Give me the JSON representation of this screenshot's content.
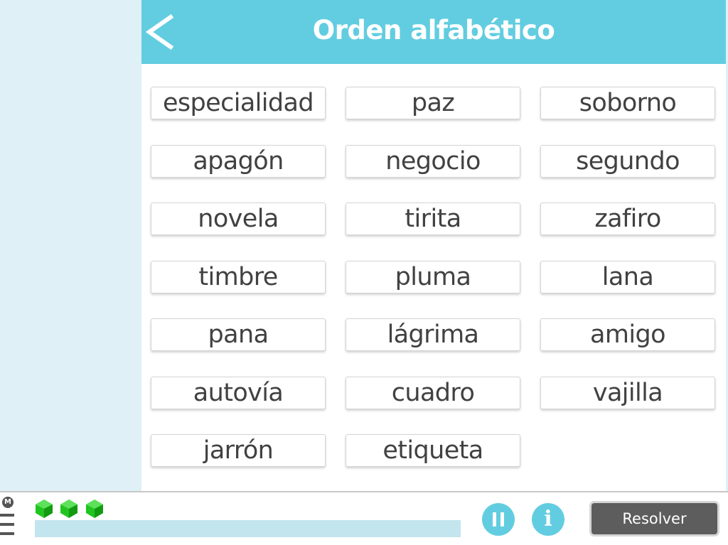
{
  "header": {
    "title": "Orden alfabético",
    "back_label": "<"
  },
  "words": [
    [
      "especialidad",
      "paz",
      "soborno"
    ],
    [
      "apagón",
      "negocio",
      "segundo"
    ],
    [
      "novela",
      "tirita",
      "zafiro"
    ],
    [
      "timbre",
      "pluma",
      "lana"
    ],
    [
      "pana",
      "lágrima",
      "amigo"
    ],
    [
      "autovía",
      "cuadro",
      "vajilla"
    ],
    [
      "jarrón",
      "etiqueta"
    ]
  ],
  "footer": {
    "menu_logo": "M",
    "lives": 3,
    "progress": 0,
    "info_label": "i",
    "resolve_label": "Resolver"
  },
  "colors": {
    "accent": "#62cde0",
    "side_panel": "#dff0f6",
    "word_text": "#414141",
    "gem": "#22c41f",
    "progress_track": "#c3e5ed",
    "resolve_button": "#5d5d5d"
  },
  "icons": {
    "back": "chevron-left-icon",
    "menu": "hamburger-menu-icon",
    "pause": "pause-icon",
    "info": "info-icon",
    "lives": "green-gem-icon"
  }
}
